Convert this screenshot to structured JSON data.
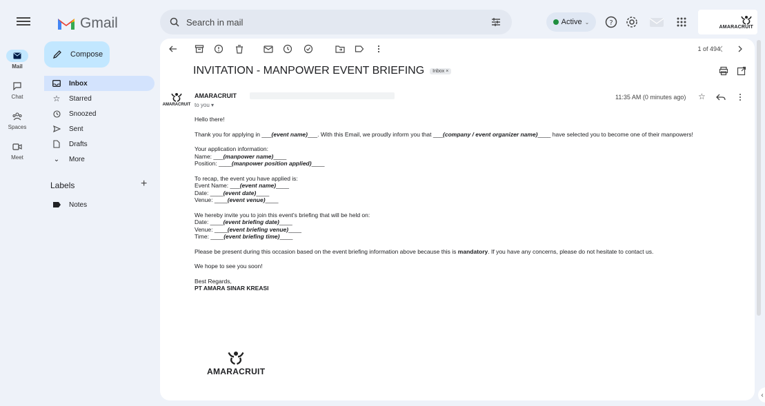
{
  "app": {
    "name": "Gmail"
  },
  "search": {
    "placeholder": "Search in mail"
  },
  "status": {
    "label": "Active"
  },
  "brand": {
    "name": "AMARACRUIT"
  },
  "rail": [
    {
      "label": "Mail"
    },
    {
      "label": "Chat"
    },
    {
      "label": "Spaces"
    },
    {
      "label": "Meet"
    }
  ],
  "compose": {
    "label": "Compose"
  },
  "nav": [
    {
      "label": "Inbox"
    },
    {
      "label": "Starred"
    },
    {
      "label": "Snoozed"
    },
    {
      "label": "Sent"
    },
    {
      "label": "Drafts"
    },
    {
      "label": "More"
    }
  ],
  "labels": {
    "title": "Labels",
    "add": "+",
    "items": [
      {
        "label": "Notes"
      }
    ]
  },
  "toolbar": {
    "count": "1 of 494"
  },
  "email": {
    "subject": "INVITATION - MANPOWER EVENT BRIEFING",
    "chip": "Inbox ×",
    "sender": "AMARACRUIT",
    "to": "to you ▾",
    "time": "11:35 AM (0 minutes ago)",
    "greeting": "Hello there!",
    "p1_a": "Thank you for applying in ___",
    "p1_b": "(event name)",
    "p1_c": "___. With this Email, we proudly inform you that ___",
    "p1_d": "(company / event organizer name)",
    "p1_e": "____ have selected you to become one of their manpowers!",
    "app_info": "Your application information:",
    "name_lbl": "Name: ___",
    "name_val": "(manpower name)",
    "name_tail": "____",
    "pos_lbl": "Position: ____",
    "pos_val": "(manpower position applied)",
    "pos_tail": "____",
    "recap": "To recap, the event you have applied is:",
    "ev_lbl": "Event Name: ___",
    "ev_val": "(event name)",
    "ev_tail": "____",
    "date_lbl": "Date: ____",
    "date_val": "(event date)",
    "date_tail": "____",
    "venue_lbl": "Venue: ____",
    "venue_val": "(event venue)",
    "venue_tail": "____",
    "invite": "We hereby invite you to join this event's briefing that will be held on:",
    "bdate_lbl": "Date: ____",
    "bdate_val": "(event briefing date)",
    "bdate_tail": "____",
    "bvenue_lbl": "Venue: ____",
    "bvenue_val": "(event briefing venue)",
    "bvenue_tail": "____",
    "btime_lbl": "Time: ____",
    "btime_val": "(event briefing time)",
    "btime_tail": "____",
    "present_a": "Please be present during this occasion based on the event briefing information above because this is ",
    "present_b": "mandatory",
    "present_c": ". If you have any concerns, please do not hesitate to contact us.",
    "hope": "We hope to see you soon!",
    "regards": "Best Regards,",
    "company": "PT AMARA SINAR KREASI"
  }
}
